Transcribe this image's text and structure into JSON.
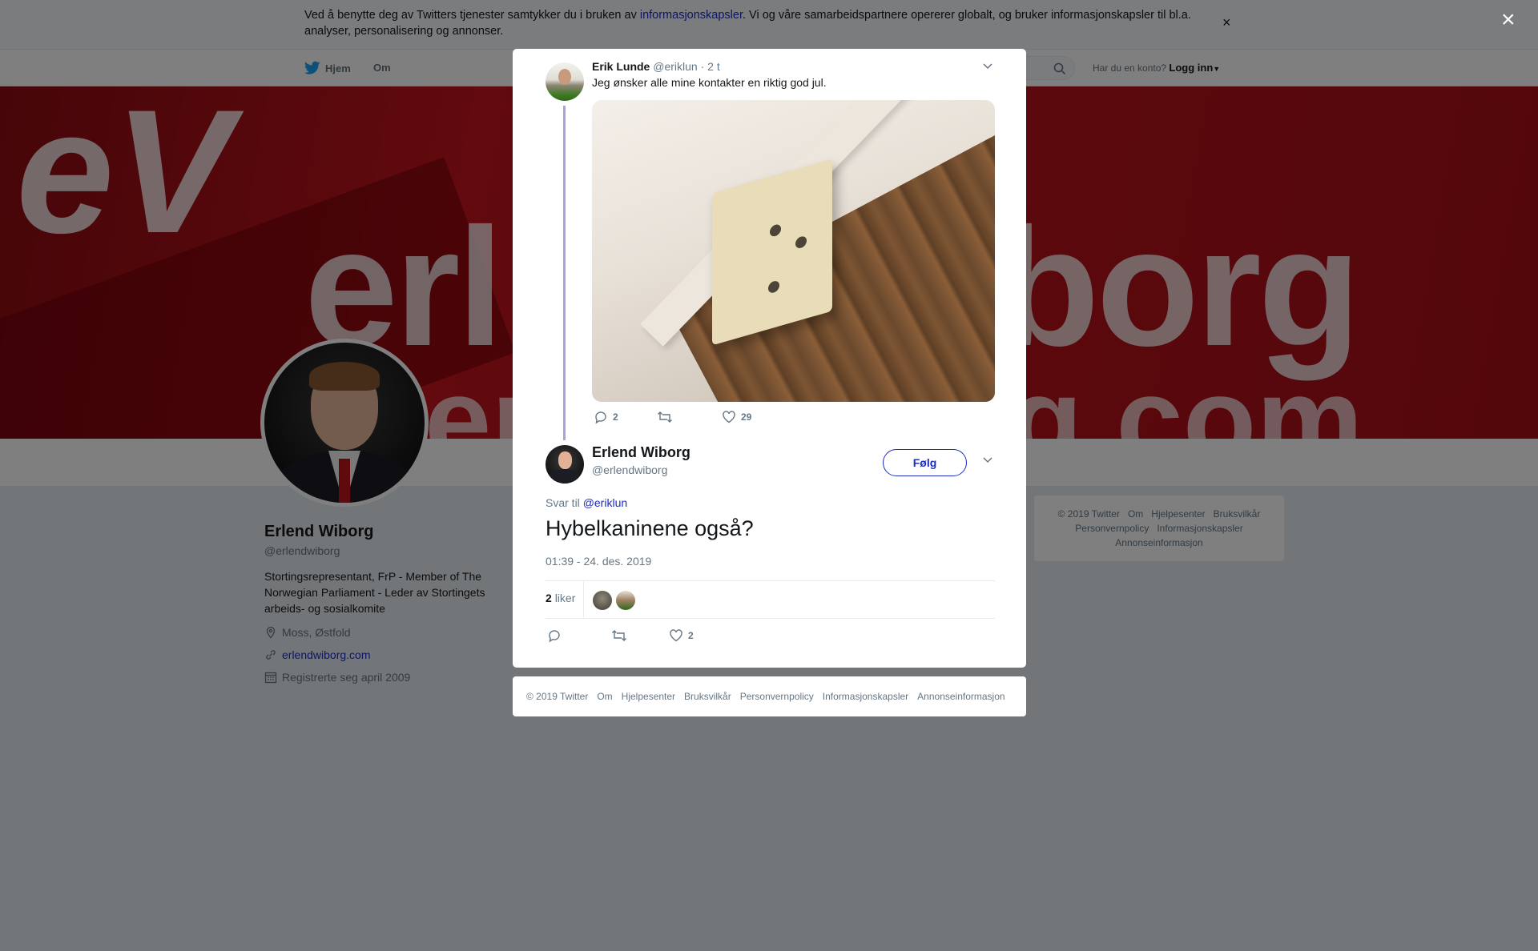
{
  "cookie_banner": {
    "text_before": "Ved å benytte deg av Twitters tjenester samtykker du i bruken av ",
    "link": "informasjonskapsler",
    "text_after": ". Vi og våre samarbeidspartnere opererer globalt, og bruker informasjonskapsler til bl.a. analyser, personalisering og annonser.",
    "close": "×"
  },
  "nav": {
    "home": "Hjem",
    "about": "Om",
    "login_prompt": "Har du en konto?",
    "login": "Logg inn"
  },
  "banner": {
    "logo": "eV",
    "word_left": "erl",
    "word_right": "iborg",
    "url_left": "er",
    "url_right": "g.com"
  },
  "profile": {
    "name": "Erlend Wiborg",
    "handle": "@erlendwiborg",
    "bio": "Stortingsrepresentant, FrP - Member of The Norwegian Parliament - Leder av Stortingets arbeids- og sosialkomite",
    "location": "Moss, Østfold",
    "website": "erlendwiborg.com",
    "joined": "Registrerte seg april 2009"
  },
  "sidebar_footer": [
    "© 2019 Twitter",
    "Om",
    "Hjelpesenter",
    "Bruksvilkår",
    "Personvernpolicy",
    "Informasjonskapsler",
    "Annonseinformasjon"
  ],
  "overlay_close": "×",
  "parent_tweet": {
    "name": "Erik Lunde",
    "handle": "@eriklun",
    "time": "· 2 t",
    "text": "Jeg ønsker alle mine kontakter en riktig god jul.",
    "replies": "2",
    "retweets": "",
    "likes": "29"
  },
  "main_tweet": {
    "name": "Erlend Wiborg",
    "handle": "@erlendwiborg",
    "follow": "Følg",
    "reply_to_label": "Svar til",
    "reply_to_handle": "@eriklun",
    "text": "Hybelkaninene også?",
    "timestamp": "01:39 - 24. des. 2019",
    "likes_count": "2",
    "likes_label": "liker",
    "replies": "",
    "retweets": "",
    "likes": "2"
  },
  "modal_footer": [
    "© 2019 Twitter",
    "Om",
    "Hjelpesenter",
    "Bruksvilkår",
    "Personvernpolicy",
    "Informasjonskapsler",
    "Annonseinformasjon"
  ],
  "colors": {
    "link": "#1b2cc1",
    "twitter_blue": "#1da1f2",
    "thread_line": "#a9a2dc",
    "banner_red": "#c4141c"
  }
}
